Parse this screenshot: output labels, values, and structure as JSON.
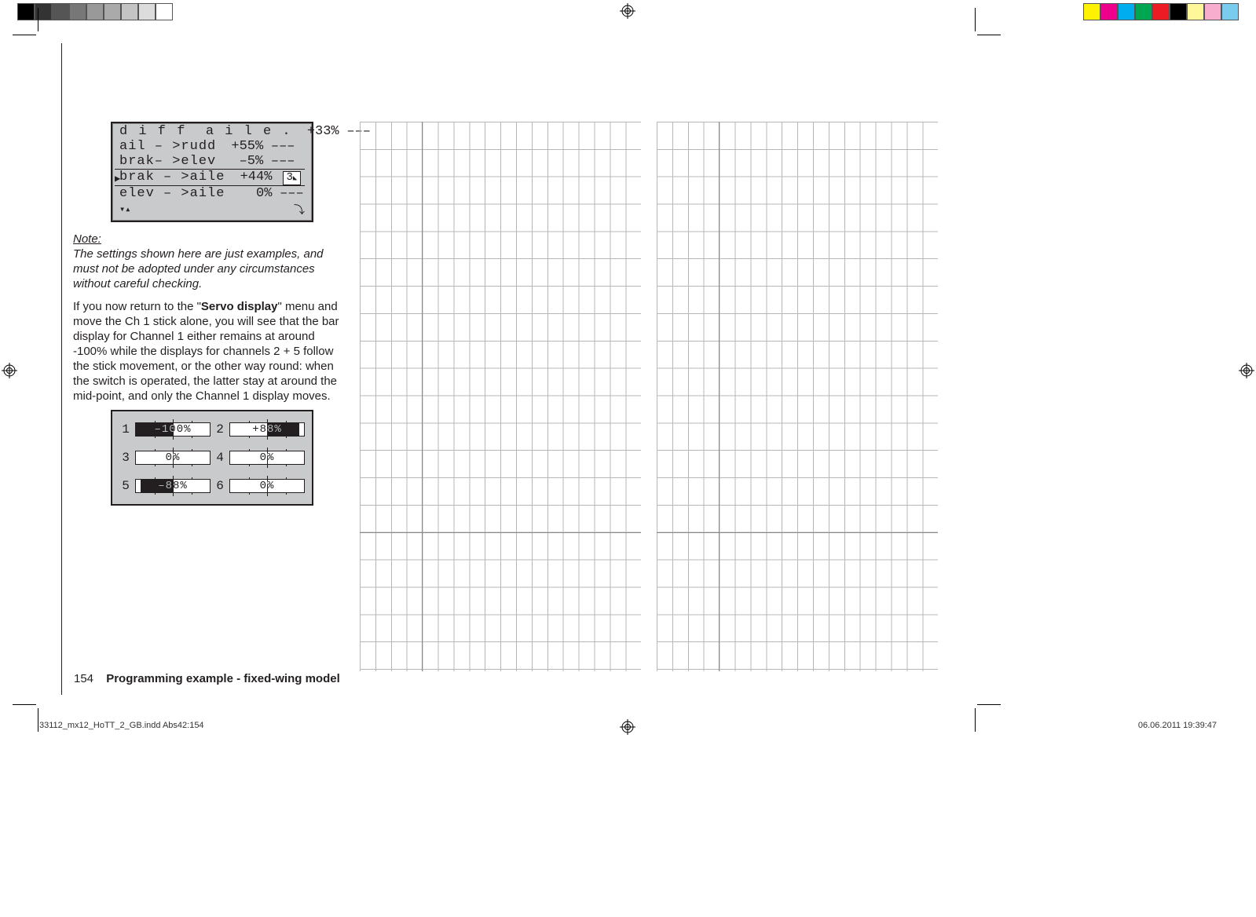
{
  "swatches_left": [
    "#000000",
    "#333333",
    "#555555",
    "#777777",
    "#999999",
    "#aaaaaa",
    "#c4c4c4",
    "#dcdcdc",
    "#ffffff"
  ],
  "swatches_right": [
    "#fff200",
    "#ec008c",
    "#00aeef",
    "#00a651",
    "#ed1c24",
    "#000000",
    "#fff799",
    "#f7adce",
    "#7accee"
  ],
  "lcd": {
    "rows": [
      {
        "label": "d i f f  a i l e .",
        "value": "+33%",
        "switch": "–––"
      },
      {
        "label": "ail – >rudd",
        "value": "+55%",
        "switch": "–––"
      },
      {
        "label": "brak– >elev",
        "value": "–5%",
        "switch": "–––"
      },
      {
        "label": "brak – >aile",
        "value": "+44%",
        "switch": "3",
        "selected": true
      },
      {
        "label": "elev – >aile",
        "value": "0%",
        "switch": "–––"
      }
    ]
  },
  "note": {
    "head": "Note:",
    "body": "The settings shown here are just examples, and must not be adopted under any circumstances without careful checking."
  },
  "paragraph_parts": {
    "a": "If you now return to the \"",
    "b": "Servo display",
    "c": "\" menu and move the Ch 1 stick alone, you will see that the bar display for Channel 1 either remains at around -100% while the displays for channels 2 + 5 follow the stick movement, or the other way round: when the switch is operated, the latter stay at around the mid-point, and only the Channel 1 display moves."
  },
  "servo": [
    {
      "n": "1",
      "pct": -100,
      "label": "–100%"
    },
    {
      "n": "2",
      "pct": 88,
      "label": "+88%"
    },
    {
      "n": "3",
      "pct": 0,
      "label": "0%"
    },
    {
      "n": "4",
      "pct": 0,
      "label": "0%"
    },
    {
      "n": "5",
      "pct": -88,
      "label": "–88%"
    },
    {
      "n": "6",
      "pct": 0,
      "label": "0%"
    }
  ],
  "footer": {
    "page": "154",
    "title": "Programming example - ﬁxed-wing model"
  },
  "slug": {
    "left": "33112_mx12_HoTT_2_GB.indd   Abs42:154",
    "right": "06.06.2011   19:39:47"
  }
}
